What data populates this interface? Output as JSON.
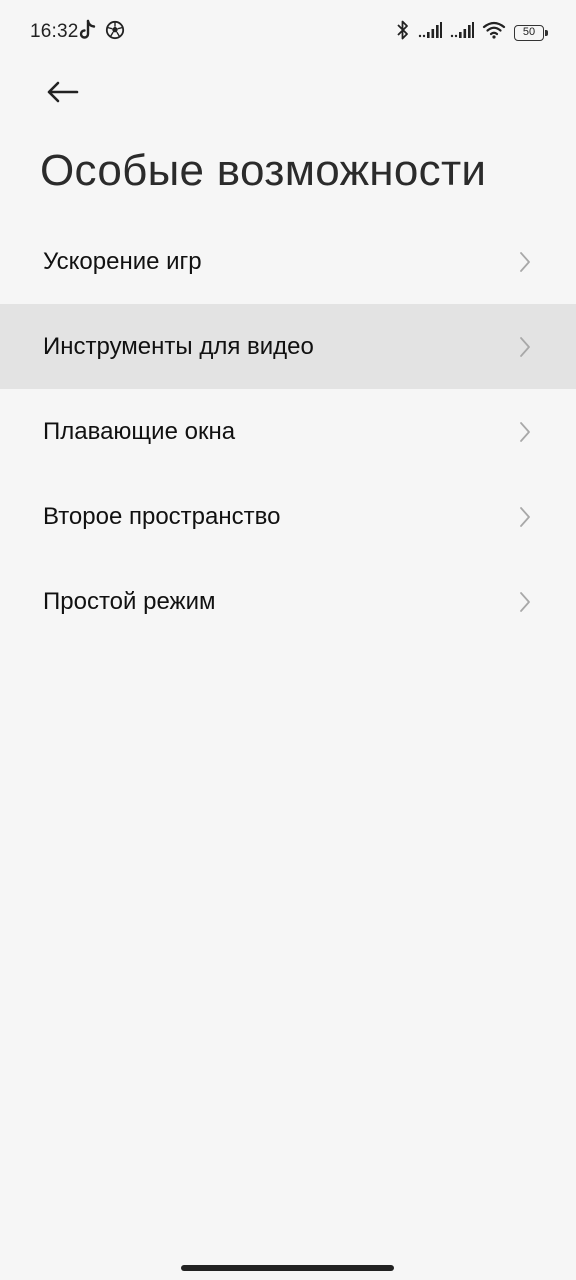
{
  "status_bar": {
    "time": "16:32",
    "left_icons": [
      "tiktok-icon",
      "soccer-ball-icon"
    ],
    "right_icons": [
      "bluetooth-icon",
      "signal-icon",
      "signal-icon",
      "wifi-icon",
      "battery-icon"
    ],
    "battery_level": "50"
  },
  "header": {
    "back_icon": "arrow-left-icon",
    "title": "Особые возможности"
  },
  "menu": {
    "items": [
      {
        "label": "Ускорение игр",
        "highlighted": false
      },
      {
        "label": "Инструменты для видео",
        "highlighted": true
      },
      {
        "label": "Плавающие окна",
        "highlighted": false
      },
      {
        "label": "Второе пространство",
        "highlighted": false
      },
      {
        "label": "Простой режим",
        "highlighted": false
      }
    ],
    "chevron_icon": "chevron-right-icon"
  },
  "colors": {
    "background": "#f6f6f6",
    "highlight": "#e3e3e3",
    "text": "#111111",
    "chevron": "#a8a8a8"
  }
}
